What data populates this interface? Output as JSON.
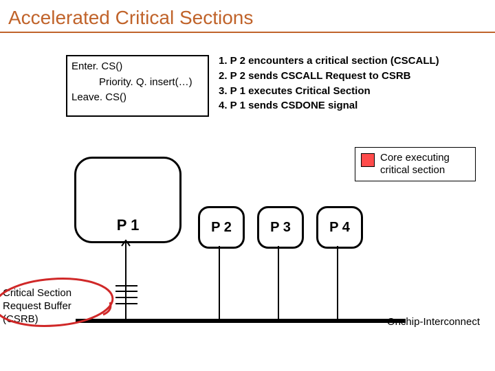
{
  "title": "Accelerated Critical Sections",
  "code_box": {
    "line1": "Enter. CS()",
    "line2": "Priority. Q. insert(…)",
    "line3": "Leave. CS()"
  },
  "steps": {
    "s1": "1. P 2 encounters a critical section (CSCALL)",
    "s2": "2. P 2 sends CSCALL Request to CSRB",
    "s3": "3. P 1 executes Critical Section",
    "s4": "4. P 1 sends CSDONE signal"
  },
  "legend": {
    "label": "Core executing critical section"
  },
  "cores": {
    "p1": "P 1",
    "p2": "P 2",
    "p3": "P 3",
    "p4": "P 4"
  },
  "csrb_label": "Critical Section Request Buffer (CSRB)",
  "onchip_label": "Onchip-Interconnect"
}
